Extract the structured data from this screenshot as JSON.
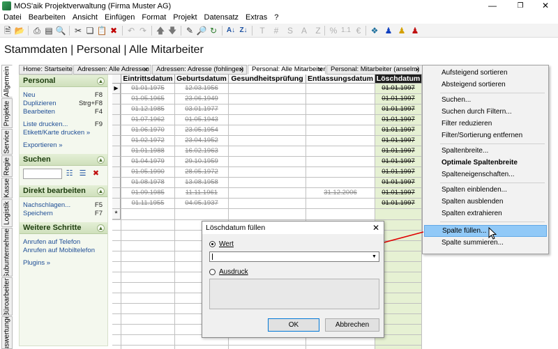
{
  "window": {
    "title": "MOS'aik Projektverwaltung (Firma Muster AG)"
  },
  "menu": [
    "Datei",
    "Bearbeiten",
    "Ansicht",
    "Einfügen",
    "Format",
    "Projekt",
    "Datensatz",
    "Extras",
    "?"
  ],
  "toolbar": {
    "format_letters": [
      "T",
      "#",
      "S",
      "A",
      "Z"
    ],
    "percent": "%",
    "number_format": "1.1",
    "currency": "€"
  },
  "page": {
    "heading": "Stammdaten | Personal | Alle Mitarbeiter"
  },
  "side_tabs": [
    "Allgemein",
    "Projekte",
    "Service",
    "Regie",
    "Kasse",
    "Logistik",
    "Subunternehmer",
    "Büroarbeiten",
    "Auswertungen"
  ],
  "doc_tabs": [
    "Home: Startseite",
    "Adressen: Alle Adressen",
    "Adressen: Adresse (fohlinger)",
    "Personal: Alle Mitarbeiter",
    "Personal: Mitarbeiter (anselm)"
  ],
  "left_panel": {
    "personal": {
      "title": "Personal",
      "items": [
        {
          "label": "Neu",
          "shortcut": "F8"
        },
        {
          "label": "Duplizieren",
          "shortcut": "Strg+F8"
        },
        {
          "label": "Bearbeiten",
          "shortcut": "F4"
        },
        {
          "label": "Liste drucken...",
          "shortcut": "F9"
        },
        {
          "label": "Etikett/Karte drucken »",
          "shortcut": ""
        },
        {
          "label": "Exportieren »",
          "shortcut": ""
        }
      ]
    },
    "suchen": {
      "title": "Suchen"
    },
    "direkt": {
      "title": "Direkt bearbeiten",
      "items": [
        {
          "label": "Nachschlagen...",
          "shortcut": "F5"
        },
        {
          "label": "Speichern",
          "shortcut": "F7"
        }
      ]
    },
    "weitere": {
      "title": "Weitere Schritte",
      "items": [
        {
          "label": "Anrufen auf Telefon"
        },
        {
          "label": "Anrufen auf Mobiltelefon"
        },
        {
          "label": "Plugins »"
        }
      ]
    }
  },
  "grid": {
    "columns": [
      "Eintrittsdatum",
      "Geburtsdatum",
      "Gesundheitsprüfung",
      "Entlassungsdatum",
      "Löschdatum"
    ],
    "rows": [
      [
        "01.01.1975",
        "12.03.1956",
        "",
        "",
        "01.01.1997"
      ],
      [
        "01.05.1965",
        "23.06.1949",
        "",
        "",
        "01.01.1997"
      ],
      [
        "01.12.1985",
        "03.01.1977",
        "",
        "",
        "01.01.1997"
      ],
      [
        "01.07.1962",
        "01.05.1943",
        "",
        "",
        "01.01.1997"
      ],
      [
        "01.06.1970",
        "23.05.1954",
        "",
        "",
        "01.01.1997"
      ],
      [
        "01.02.1972",
        "23.04.1952",
        "",
        "",
        "01.01.1997"
      ],
      [
        "01.01.1988",
        "16.02.1963",
        "",
        "",
        "01.01.1997"
      ],
      [
        "01.04.1979",
        "29.10.1959",
        "",
        "",
        "01.01.1997"
      ],
      [
        "01.05.1990",
        "28.05.1972",
        "",
        "",
        "01.01.1997"
      ],
      [
        "01.08.1978",
        "13.08.1958",
        "",
        "",
        "01.01.1997"
      ],
      [
        "01.09.1985",
        "11.11.1961",
        "",
        "31.12.2006",
        "01.01.1997"
      ],
      [
        "01.11.1955",
        "04.05.1937",
        "",
        "",
        "01.01.1997"
      ]
    ],
    "new_row_marker": "*"
  },
  "context_menu": {
    "items": [
      {
        "label": "Aufsteigend sortieren"
      },
      {
        "label": "Absteigend sortieren"
      },
      {
        "label": "Suchen..."
      },
      {
        "label": "Suchen durch Filtern..."
      },
      {
        "label": "Filter reduzieren"
      },
      {
        "label": "Filter/Sortierung entfernen"
      },
      {
        "label": "Spaltenbreite..."
      },
      {
        "label": "Optimale Spaltenbreite",
        "bold": true
      },
      {
        "label": "Spalteneigenschaften..."
      },
      {
        "label": "Spalten einblenden..."
      },
      {
        "label": "Spalten ausblenden"
      },
      {
        "label": "Spalten extrahieren"
      },
      {
        "label": "Spalte füllen...",
        "highlighted": true
      },
      {
        "label": "Spalte summieren..."
      }
    ]
  },
  "dialog": {
    "title": "Löschdatum füllen",
    "option_value": "Wert",
    "option_expression": "Ausdruck",
    "value": "",
    "ok": "OK",
    "cancel": "Abbrechen"
  }
}
